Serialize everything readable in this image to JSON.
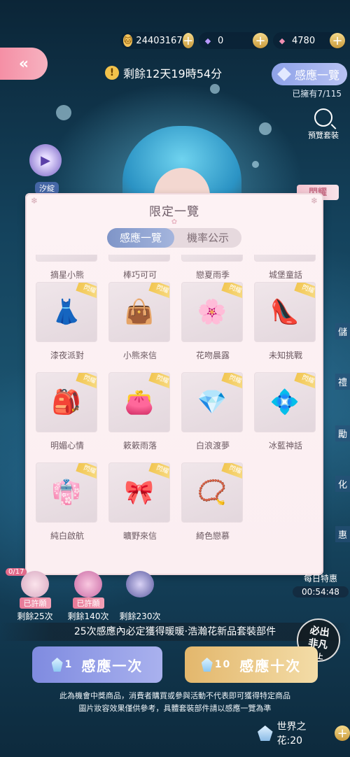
{
  "currency": [
    {
      "icon": "cat-icon",
      "value": "24403167",
      "color": "#f3c25b"
    },
    {
      "icon": "purple-diamond-icon",
      "value": "0",
      "color": "#9f7ce6"
    },
    {
      "icon": "pink-diamond-icon",
      "value": "4780",
      "color": "#f08fb2"
    }
  ],
  "timer": {
    "text": "剩餘12天19時54分",
    "icon": "exclamation"
  },
  "top_right_button": {
    "label": "感應一覽"
  },
  "owned_text": "已擁有7/115",
  "preview_label": "預覽套裝",
  "player_label": "汐綻",
  "side_tag": "閃耀",
  "side_labels": [
    "儲",
    "禮",
    "勵",
    "化",
    "惠"
  ],
  "modal": {
    "title": "限定一覽",
    "tabs": [
      {
        "label": "感應一覽",
        "active": true
      },
      {
        "label": "機率公示",
        "active": false
      }
    ],
    "badge_text": "閃耀",
    "items": [
      {
        "name": "摘星小熊",
        "art": "🧸"
      },
      {
        "name": "棒巧可可",
        "art": "🍫"
      },
      {
        "name": "戀夏雨季",
        "art": "☂"
      },
      {
        "name": "城堡童話",
        "art": "🏰"
      },
      {
        "name": "漆夜派對",
        "art": "👗"
      },
      {
        "name": "小熊來信",
        "art": "👜"
      },
      {
        "name": "花吻晨露",
        "art": "🌸"
      },
      {
        "name": "未知挑戰",
        "art": "👠"
      },
      {
        "name": "明媚心情",
        "art": "🎒"
      },
      {
        "name": "簌簌雨落",
        "art": "👛"
      },
      {
        "name": "白浪渡夢",
        "art": "💎"
      },
      {
        "name": "冰藍神話",
        "art": "💠"
      },
      {
        "name": "純白啟航",
        "art": "👘"
      },
      {
        "name": "曠野來信",
        "art": "🎀"
      },
      {
        "name": "綺色戀慕",
        "art": "📿"
      }
    ]
  },
  "counter": "0/17",
  "rewards": [
    {
      "tag": "已許願",
      "remaining": "剩餘25次"
    },
    {
      "tag": "已許願",
      "remaining": "剩餘140次"
    },
    {
      "tag": "",
      "remaining": "剩餘230次"
    }
  ],
  "daily": {
    "name": "每日特惠",
    "countdown": "00:54:48"
  },
  "guarantee_text": "25次感應內必定獲得暖暖·浩瀚花新品套裝部件",
  "must_badge": {
    "line1": "必出",
    "line2": "非凡",
    "line3": "以上"
  },
  "draw_one": {
    "count": "1",
    "label": "感應一次"
  },
  "draw_ten": {
    "count": "10",
    "label": "感應十次"
  },
  "notice": {
    "line1": "此為機會中獎商品，消費者購買或參與活動不代表即可獲得特定商品",
    "line2": "圖片妝容效果僅供參考，具體套裝部件請以感應一覽為準"
  },
  "world_flower": {
    "label": "世界之花:20"
  }
}
